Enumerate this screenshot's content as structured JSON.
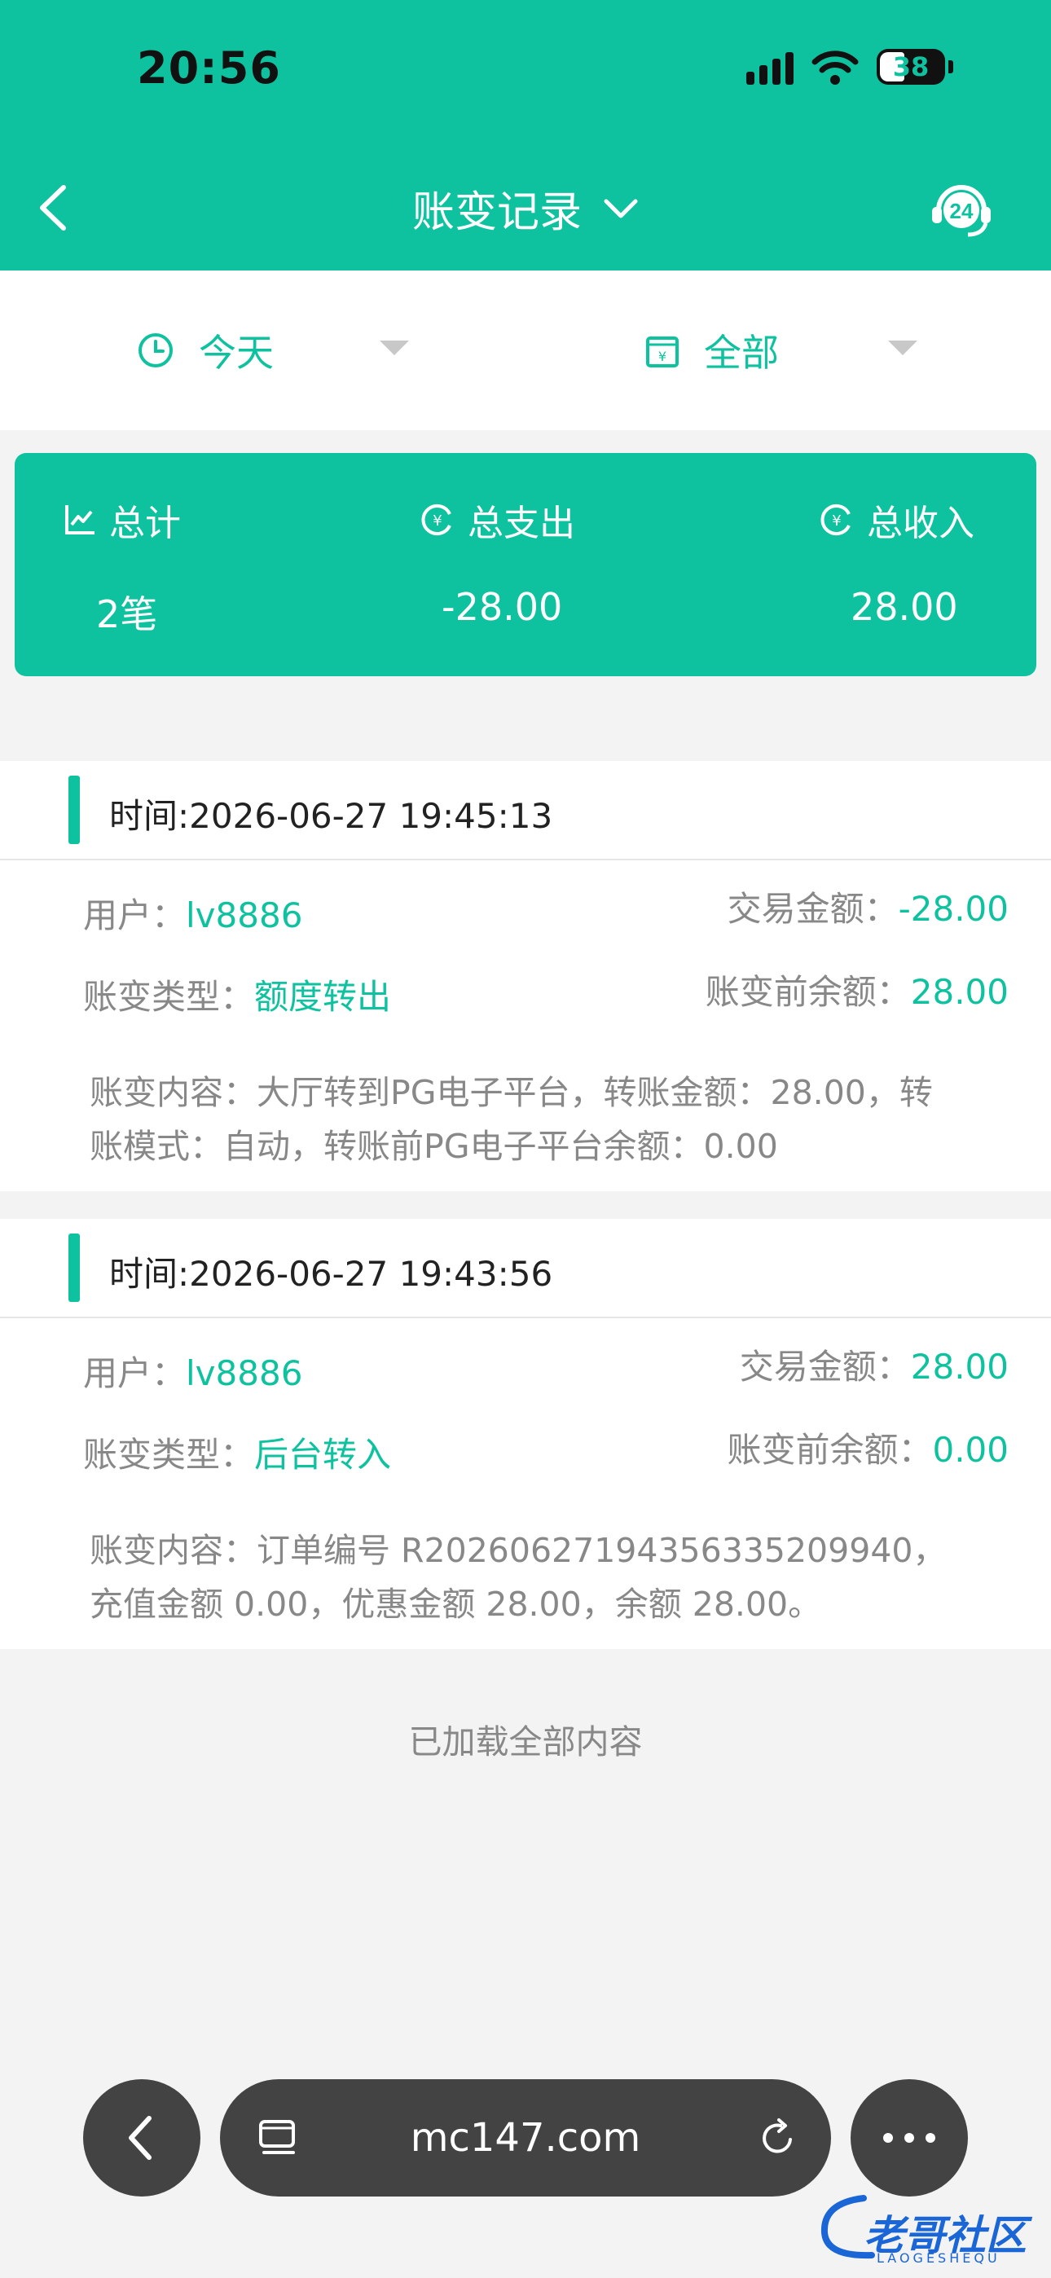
{
  "status_bar": {
    "time": "20:56",
    "battery": "38"
  },
  "header": {
    "title": "账变记录",
    "support_badge": "24"
  },
  "filters": {
    "date": "今天",
    "type": "全部"
  },
  "summary": {
    "total_label": "总计",
    "total_value": "2笔",
    "expense_label": "总支出",
    "expense_value": "-28.00",
    "income_label": "总收入",
    "income_value": "28.00"
  },
  "records": [
    {
      "time": "时间:2026-06-27 19:45:13",
      "user_label": "用户：",
      "user": "lv8886",
      "amount_label": "交易金额：",
      "amount": "-28.00",
      "type_label": "账变类型：",
      "type": "额度转出",
      "balance_label": "账变前余额：",
      "balance": "28.00",
      "content_line1": "账变内容：大厅转到PG电子平台，转账金额：28.00，转",
      "content_line2": "账模式：自动，转账前PG电子平台余额：0.00"
    },
    {
      "time": "时间:2026-06-27 19:43:56",
      "user_label": "用户：",
      "user": "lv8886",
      "amount_label": "交易金额：",
      "amount": "28.00",
      "type_label": "账变类型：",
      "type": "后台转入",
      "balance_label": "账变前余额：",
      "balance": "0.00",
      "content_line1": "账变内容：订单编号 R20260627194356335209940，",
      "content_line2": "充值金额 0.00，优惠金额 28.00，余额 28.00。"
    }
  ],
  "end_note": "已加载全部内容",
  "browser": {
    "url": "mc147.com"
  },
  "watermark": {
    "text": "老哥社区",
    "sub": "LAOGESHEQU"
  },
  "colors": {
    "accent": "#0fc29f",
    "pill": "#434343"
  }
}
